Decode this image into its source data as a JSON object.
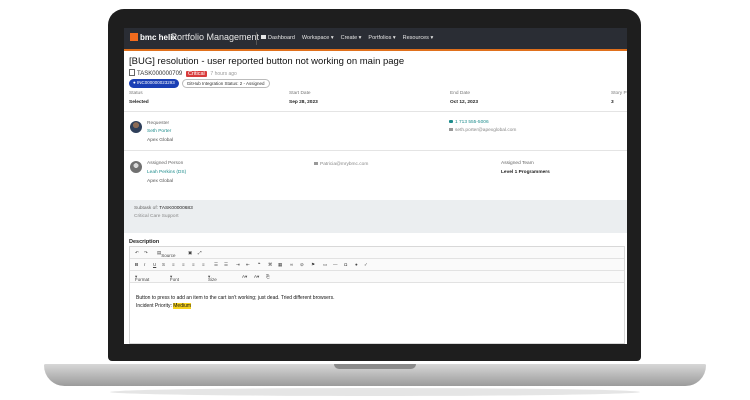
{
  "nav": {
    "brand": "bmc helix",
    "app_name": "Portfolio Management",
    "items": [
      "Dashboard",
      "Workspace ▾",
      "Create ▾",
      "Portfolios ▾",
      "Resources ▾"
    ]
  },
  "ticket": {
    "title": "[BUG] resolution - user reported button not working on main page",
    "id": "TASK000000709",
    "priority_badge": "Critical",
    "age": "7 hours ago",
    "incident_tag": "● INC000000023293",
    "integration_tag": "GitHub Integration Status: 2 - Assigned"
  },
  "fields": {
    "status_label": "Status",
    "status_value": "Selected",
    "start_label": "Start Date",
    "start_value": "Sep 28, 2023",
    "end_label": "End Date",
    "end_value": "Oct 12, 2023",
    "story_label": "Story P",
    "story_value": "3"
  },
  "requester": {
    "label": "Requester",
    "name": "Seth Porter",
    "org": "Apex Global",
    "phone": "1 713 555-5006",
    "email": "seth.porter@apexglobal.com"
  },
  "assigned": {
    "label": "Assigned Person",
    "name": "Leah Perkins (DS)",
    "org": "Apex Global",
    "email": "Patricia@mrybmc.com",
    "team_label": "Assigned Team",
    "team_value": "Level 1 Programmers"
  },
  "subtask": {
    "label": "Subtask of:",
    "id": "TASK00000683",
    "name": "Critical Care Support"
  },
  "description": {
    "label": "Description",
    "toolbar_source": "Source",
    "format_label": "Format",
    "font_label": "Font",
    "size_label": "Size",
    "line1": "Button to press to add an item to the cart isn't working; just dead. Tried different browsers.",
    "line2_prefix": "Incident Priority: ",
    "line2_highlight": "Medium"
  },
  "colors": {
    "accent": "#e0701c",
    "nav_bg": "#2a2d34",
    "critical": "#d83b3b",
    "tag_blue": "#1a3fb5",
    "link": "#1c8b8b",
    "highlight": "#f6d21e"
  }
}
